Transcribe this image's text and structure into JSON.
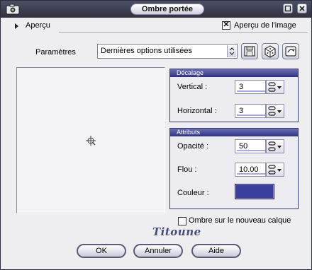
{
  "window": {
    "title": "Ombre portée",
    "icons": [
      "camera-icon",
      "maximize-icon",
      "close-icon"
    ]
  },
  "preview": {
    "label": "Aperçu",
    "image_preview_label": "Aperçu de l'image",
    "image_preview_checked": true
  },
  "params": {
    "label": "Paramètres",
    "preset_value": "Dernières options utilisées",
    "button_icons": [
      "save-floppy-icon",
      "dice-random-icon",
      "reset-preset-icon"
    ]
  },
  "offset": {
    "header": "Décalage",
    "vertical_label": "Vertical :",
    "vertical_value": "3",
    "horizontal_label": "Horizontal :",
    "horizontal_value": "3"
  },
  "attributes": {
    "header": "Attributs",
    "opacity_label": "Opacité :",
    "opacity_value": "50",
    "blur_label": "Flou :",
    "blur_value": "10.00",
    "color_label": "Couleur :",
    "color_value": "#3b3e9d"
  },
  "new_layer": {
    "label": "Ombre sur le nouveau calque",
    "checked": false
  },
  "signature": "Titoune",
  "buttons": {
    "ok": "OK",
    "cancel": "Annuler",
    "help": "Aide"
  },
  "colors": {
    "titlebar": "#3a3c4d",
    "group_header": "#3a3d8f",
    "accent": "#a7a8dc"
  }
}
